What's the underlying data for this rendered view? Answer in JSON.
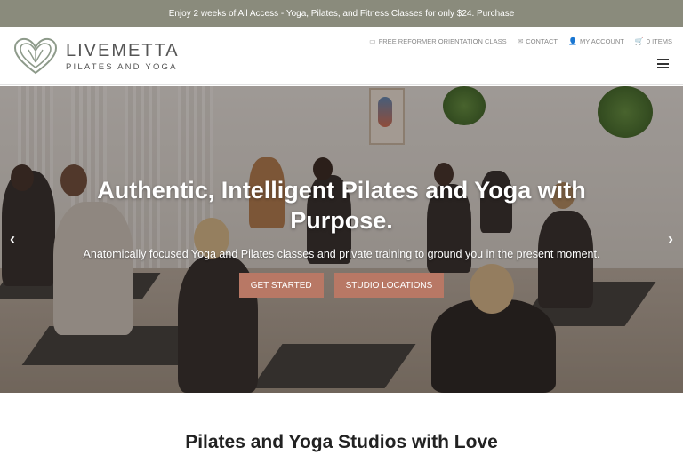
{
  "announcement": {
    "text": "Enjoy 2 weeks of All Access - Yoga, Pilates, and Fitness Classes for only $24. Purchase"
  },
  "logo": {
    "name": "LIVEMETTA",
    "tagline": "PILATES AND YOGA"
  },
  "utility_nav": [
    {
      "icon": "chat-icon",
      "label": "FREE REFORMER ORIENTATION CLASS"
    },
    {
      "icon": "mail-icon",
      "label": "CONTACT"
    },
    {
      "icon": "user-icon",
      "label": "MY ACCOUNT"
    },
    {
      "icon": "cart-icon",
      "label": "0 ITEMS"
    }
  ],
  "hero": {
    "title": "Authentic, Intelligent Pilates and Yoga with Purpose.",
    "subtitle": "Anatomically focused Yoga and Pilates classes and private training to ground you in the present moment.",
    "buttons": {
      "primary": "GET STARTED",
      "secondary": "STUDIO LOCATIONS"
    },
    "prev_arrow": "‹",
    "next_arrow": "›"
  },
  "section": {
    "title": "Pilates and Yoga Studios with Love"
  },
  "colors": {
    "topbar": "#8a8b7c",
    "button": "#b87865",
    "logo": "#555555"
  }
}
